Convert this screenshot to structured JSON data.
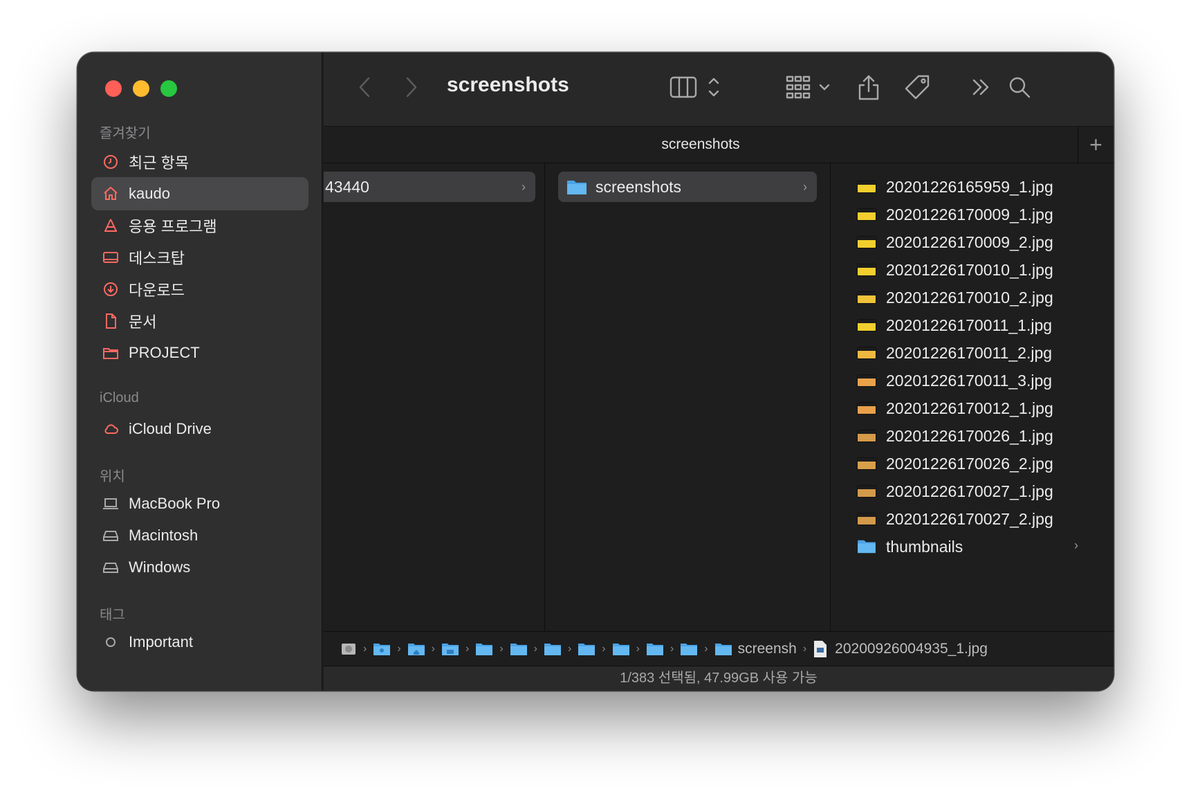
{
  "window": {
    "title": "screenshots"
  },
  "sidebar": {
    "sections": [
      {
        "title": "즐겨찾기",
        "items": [
          {
            "label": "최근 항목",
            "icon": "clock-icon"
          },
          {
            "label": "kaudo",
            "icon": "home-icon",
            "selected": true
          },
          {
            "label": "응용 프로그램",
            "icon": "apps-icon"
          },
          {
            "label": "데스크탑",
            "icon": "desktop-icon"
          },
          {
            "label": "다운로드",
            "icon": "download-icon"
          },
          {
            "label": "문서",
            "icon": "document-icon"
          },
          {
            "label": "PROJECT",
            "icon": "folder-icon"
          }
        ]
      },
      {
        "title": "iCloud",
        "items": [
          {
            "label": "iCloud Drive",
            "icon": "cloud-icon"
          }
        ]
      },
      {
        "title": "위치",
        "items": [
          {
            "label": "MacBook Pro",
            "icon": "laptop-icon"
          },
          {
            "label": "Macintosh",
            "icon": "disk-icon"
          },
          {
            "label": "Windows",
            "icon": "disk-icon"
          }
        ]
      },
      {
        "title": "태그",
        "items": [
          {
            "label": "Important",
            "icon": "tag-circle-icon"
          }
        ]
      }
    ]
  },
  "tab": {
    "title": "screenshots",
    "add_label": "+"
  },
  "columns": {
    "col1_selected": "43440",
    "col2_selected": "screenshots",
    "files": [
      "20201226165959_1.jpg",
      "20201226170009_1.jpg",
      "20201226170009_2.jpg",
      "20201226170010_1.jpg",
      "20201226170010_2.jpg",
      "20201226170011_1.jpg",
      "20201226170011_2.jpg",
      "20201226170011_3.jpg",
      "20201226170012_1.jpg",
      "20201226170026_1.jpg",
      "20201226170026_2.jpg",
      "20201226170027_1.jpg",
      "20201226170027_2.jpg"
    ],
    "folder": "thumbnails"
  },
  "pathbar": {
    "segment_label": "screensh",
    "file_label": "20200926004935_1.jpg"
  },
  "status": {
    "text": "1/383 선택됨, 47.99GB 사용 가능"
  },
  "colors": {
    "accent_icon": "#ff6961",
    "folder_blue": "#5ab4f0",
    "selection": "#48484a"
  }
}
